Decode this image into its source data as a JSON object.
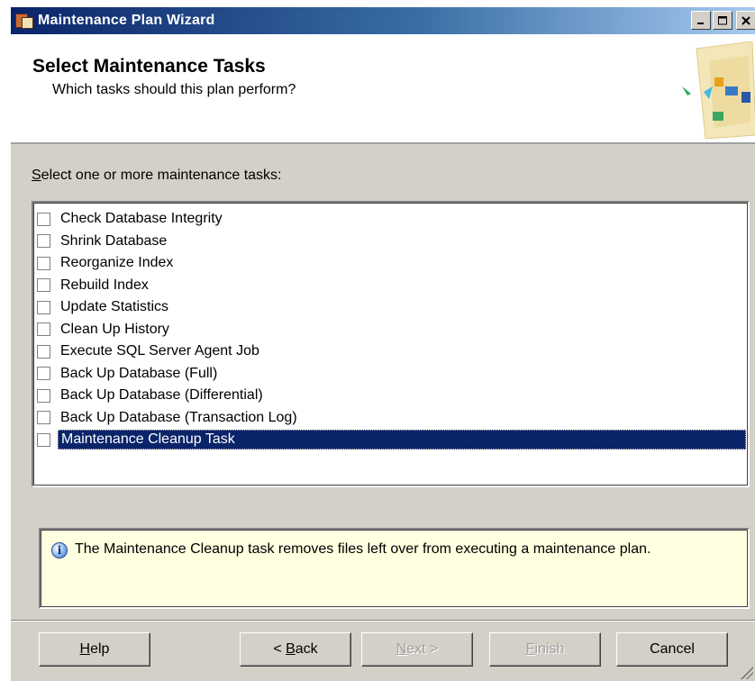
{
  "window": {
    "title": "Maintenance Plan Wizard",
    "controls": [
      "minimize",
      "maximize",
      "close"
    ]
  },
  "header": {
    "title": "Select Maintenance Tasks",
    "subtitle": "Which tasks should this plan perform?"
  },
  "prompt": {
    "accel": "S",
    "rest": "elect one or more maintenance tasks:"
  },
  "tasks": [
    {
      "label": "Check Database Integrity",
      "checked": false,
      "selected": false
    },
    {
      "label": "Shrink Database",
      "checked": false,
      "selected": false
    },
    {
      "label": "Reorganize Index",
      "checked": false,
      "selected": false
    },
    {
      "label": "Rebuild Index",
      "checked": false,
      "selected": false
    },
    {
      "label": "Update Statistics",
      "checked": false,
      "selected": false
    },
    {
      "label": "Clean Up History",
      "checked": false,
      "selected": false
    },
    {
      "label": "Execute SQL Server Agent Job",
      "checked": false,
      "selected": false
    },
    {
      "label": "Back Up Database (Full)",
      "checked": false,
      "selected": false
    },
    {
      "label": "Back Up Database (Differential)",
      "checked": false,
      "selected": false
    },
    {
      "label": "Back Up Database (Transaction Log)",
      "checked": false,
      "selected": false
    },
    {
      "label": "Maintenance Cleanup Task",
      "checked": false,
      "selected": true
    }
  ],
  "info": {
    "icon": "info-icon",
    "text": "The Maintenance Cleanup task removes files left over from executing a maintenance plan."
  },
  "buttons": {
    "help": {
      "accel": "H",
      "rest": "elp",
      "enabled": true
    },
    "back": {
      "prefix": "< ",
      "accel": "B",
      "rest": "ack",
      "enabled": true
    },
    "next": {
      "accel": "N",
      "rest": "ext >",
      "enabled": false
    },
    "finish": {
      "accel": "F",
      "rest": "inish",
      "enabled": false
    },
    "cancel": {
      "label": "Cancel",
      "enabled": true
    }
  }
}
